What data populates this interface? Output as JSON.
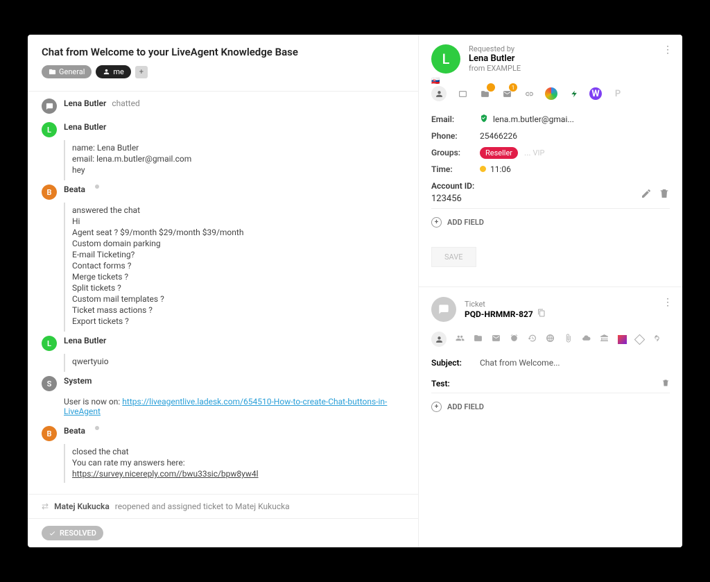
{
  "header": {
    "title": "Chat from Welcome to your LiveAgent Knowledge Base",
    "tag_general": "General",
    "tag_me": "me"
  },
  "conv": {
    "first": {
      "name": "Lena Butler",
      "action": "chatted"
    },
    "msg1": {
      "name": "Lena Butler",
      "lines": [
        "name: Lena Butler",
        "email: lena.m.butler@gmail.com",
        "hey"
      ]
    },
    "msg2": {
      "name": "Beata",
      "note": "answered the chat",
      "lines": [
        "Hi",
        "Agent seat ?    $9/month    $29/month    $39/month",
        "Custom domain parking",
        "E-mail Ticketing?",
        "Contact forms ?",
        "Merge tickets ?",
        "Split tickets ?",
        "Custom mail templates ?",
        "Ticket mass actions ?",
        "Export tickets ?"
      ]
    },
    "msg3": {
      "name": "Lena Butler",
      "lines": [
        "qwertyuio"
      ]
    },
    "sys": {
      "name": "System",
      "prefix": "User is now on:",
      "link": "https://liveagentlive.ladesk.com/654510-How-to-create-Chat-buttons-in-LiveAgent"
    },
    "msg4": {
      "name": "Beata",
      "note": "closed the chat",
      "lines": [
        "You can rate my answers here:"
      ],
      "link": "https://survey.nicereply.com//bwu33sic/bpw8yw4l"
    }
  },
  "footer": {
    "actor": "Matej Kukucka",
    "action": "reopened and assigned ticket to Matej Kukucka"
  },
  "resolved": "RESOLVED",
  "right": {
    "requested_by_label": "Requested by",
    "requester_name": "Lena Butler",
    "requester_from": "from EXAMPLE",
    "email_label": "Email:",
    "email_value": "lena.m.butler@gmai...",
    "phone_label": "Phone:",
    "phone_value": "25466226",
    "groups_label": "Groups:",
    "group_reseller": "Reseller",
    "group_vip": "VIP",
    "time_label": "Time:",
    "time_value": "11:06",
    "account_label": "Account ID:",
    "account_value": "123456",
    "add_field": "ADD FIELD",
    "save": "SAVE"
  },
  "ticket": {
    "label": "Ticket",
    "id": "PQD-HRMMR-827",
    "subject_label": "Subject:",
    "subject_value": "Chat from Welcome...",
    "test_label": "Test:",
    "add_field": "ADD FIELD"
  }
}
